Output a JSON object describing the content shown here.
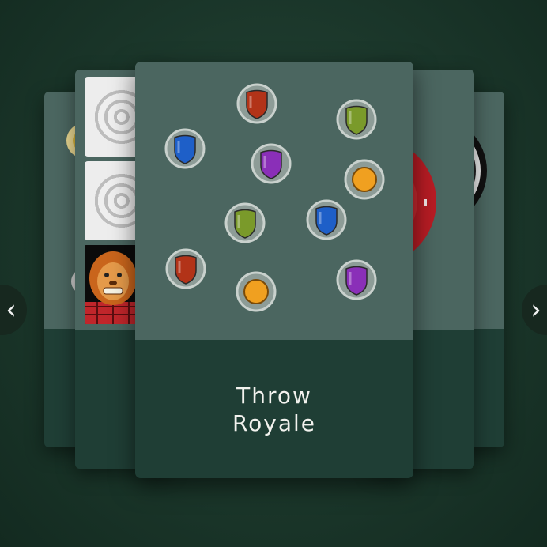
{
  "carousel": {
    "featured_title": "Throw\nRoyale",
    "prev_icon": "chevron-left-icon",
    "next_icon": "chevron-right-icon"
  },
  "colors": {
    "background": "#1d3a2d",
    "card_top": "#4b6660",
    "card_bottom": "#1f3e35",
    "shield_red": "#b23318",
    "shield_green": "#7a9a2a",
    "shield_blue": "#1e5fc8",
    "shield_purple": "#8a2fb8",
    "shield_orange": "#f0a020",
    "dartboard_red": "#b81c24"
  },
  "shields": [
    "red",
    "green",
    "blue",
    "purple",
    "orange",
    "green",
    "blue",
    "red",
    "orange",
    "purple"
  ]
}
